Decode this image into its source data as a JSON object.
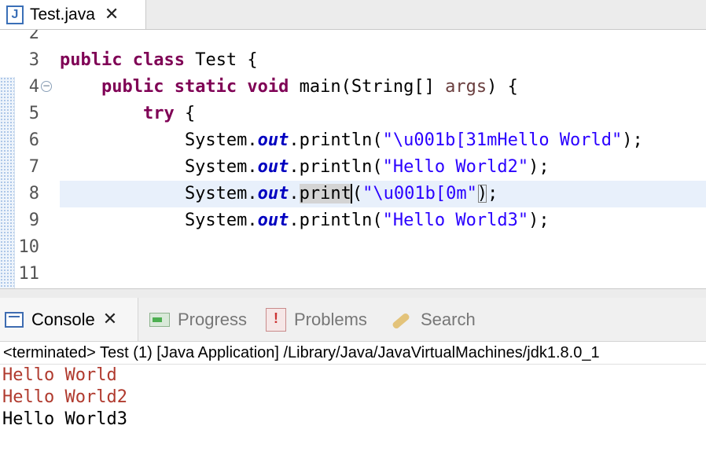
{
  "editor_tab": {
    "label": "Test.java",
    "icon": "J"
  },
  "editor": {
    "lines": [
      {
        "num": "2",
        "html": ""
      },
      {
        "num": "3",
        "html": "<span class=\"kw\">public class</span> Test {"
      },
      {
        "num": "4",
        "html": "    <span class=\"kw\">public static void</span> main(String[] <span class=\"var\">args</span>) {",
        "fold": true
      },
      {
        "num": "5",
        "html": "        <span class=\"kw\">try</span> {"
      },
      {
        "num": "6",
        "html": "            System.<span class=\"fld\">out</span>.println(<span class=\"str\">\"\\u001b[31mHello World\"</span>);"
      },
      {
        "num": "7",
        "html": "            System.<span class=\"fld\">out</span>.println(<span class=\"str\">\"Hello World2\"</span>);"
      },
      {
        "num": "8",
        "html": "            System.<span class=\"fld\">out</span>.<span class=\"sel\">print</span><span class=\"caret\"></span>(<span class=\"str\">\"\\u001b[0m\"</span><span class=\"bracket\">)</span>;",
        "current": true
      },
      {
        "num": "9",
        "html": "            System.<span class=\"fld\">out</span>.println(<span class=\"str\">\"Hello World3\"</span>);"
      },
      {
        "num": "10",
        "html": ""
      },
      {
        "num": "11",
        "html": ""
      }
    ]
  },
  "view_tabs": {
    "console": "Console",
    "progress": "Progress",
    "problems": "Problems",
    "search": "Search"
  },
  "console": {
    "status": "<terminated> Test (1) [Java Application] /Library/Java/JavaVirtualMachines/jdk1.8.0_1",
    "output": [
      {
        "text": "Hello World",
        "color": "#b03a2e"
      },
      {
        "text": "Hello World2",
        "color": "#b03a2e"
      },
      {
        "text": "Hello World3",
        "color": "#000000"
      }
    ]
  },
  "colors": {
    "keyword": "#7f0055",
    "string": "#2a00ff",
    "field": "#0000c0",
    "current_line": "#e8f0fb"
  }
}
